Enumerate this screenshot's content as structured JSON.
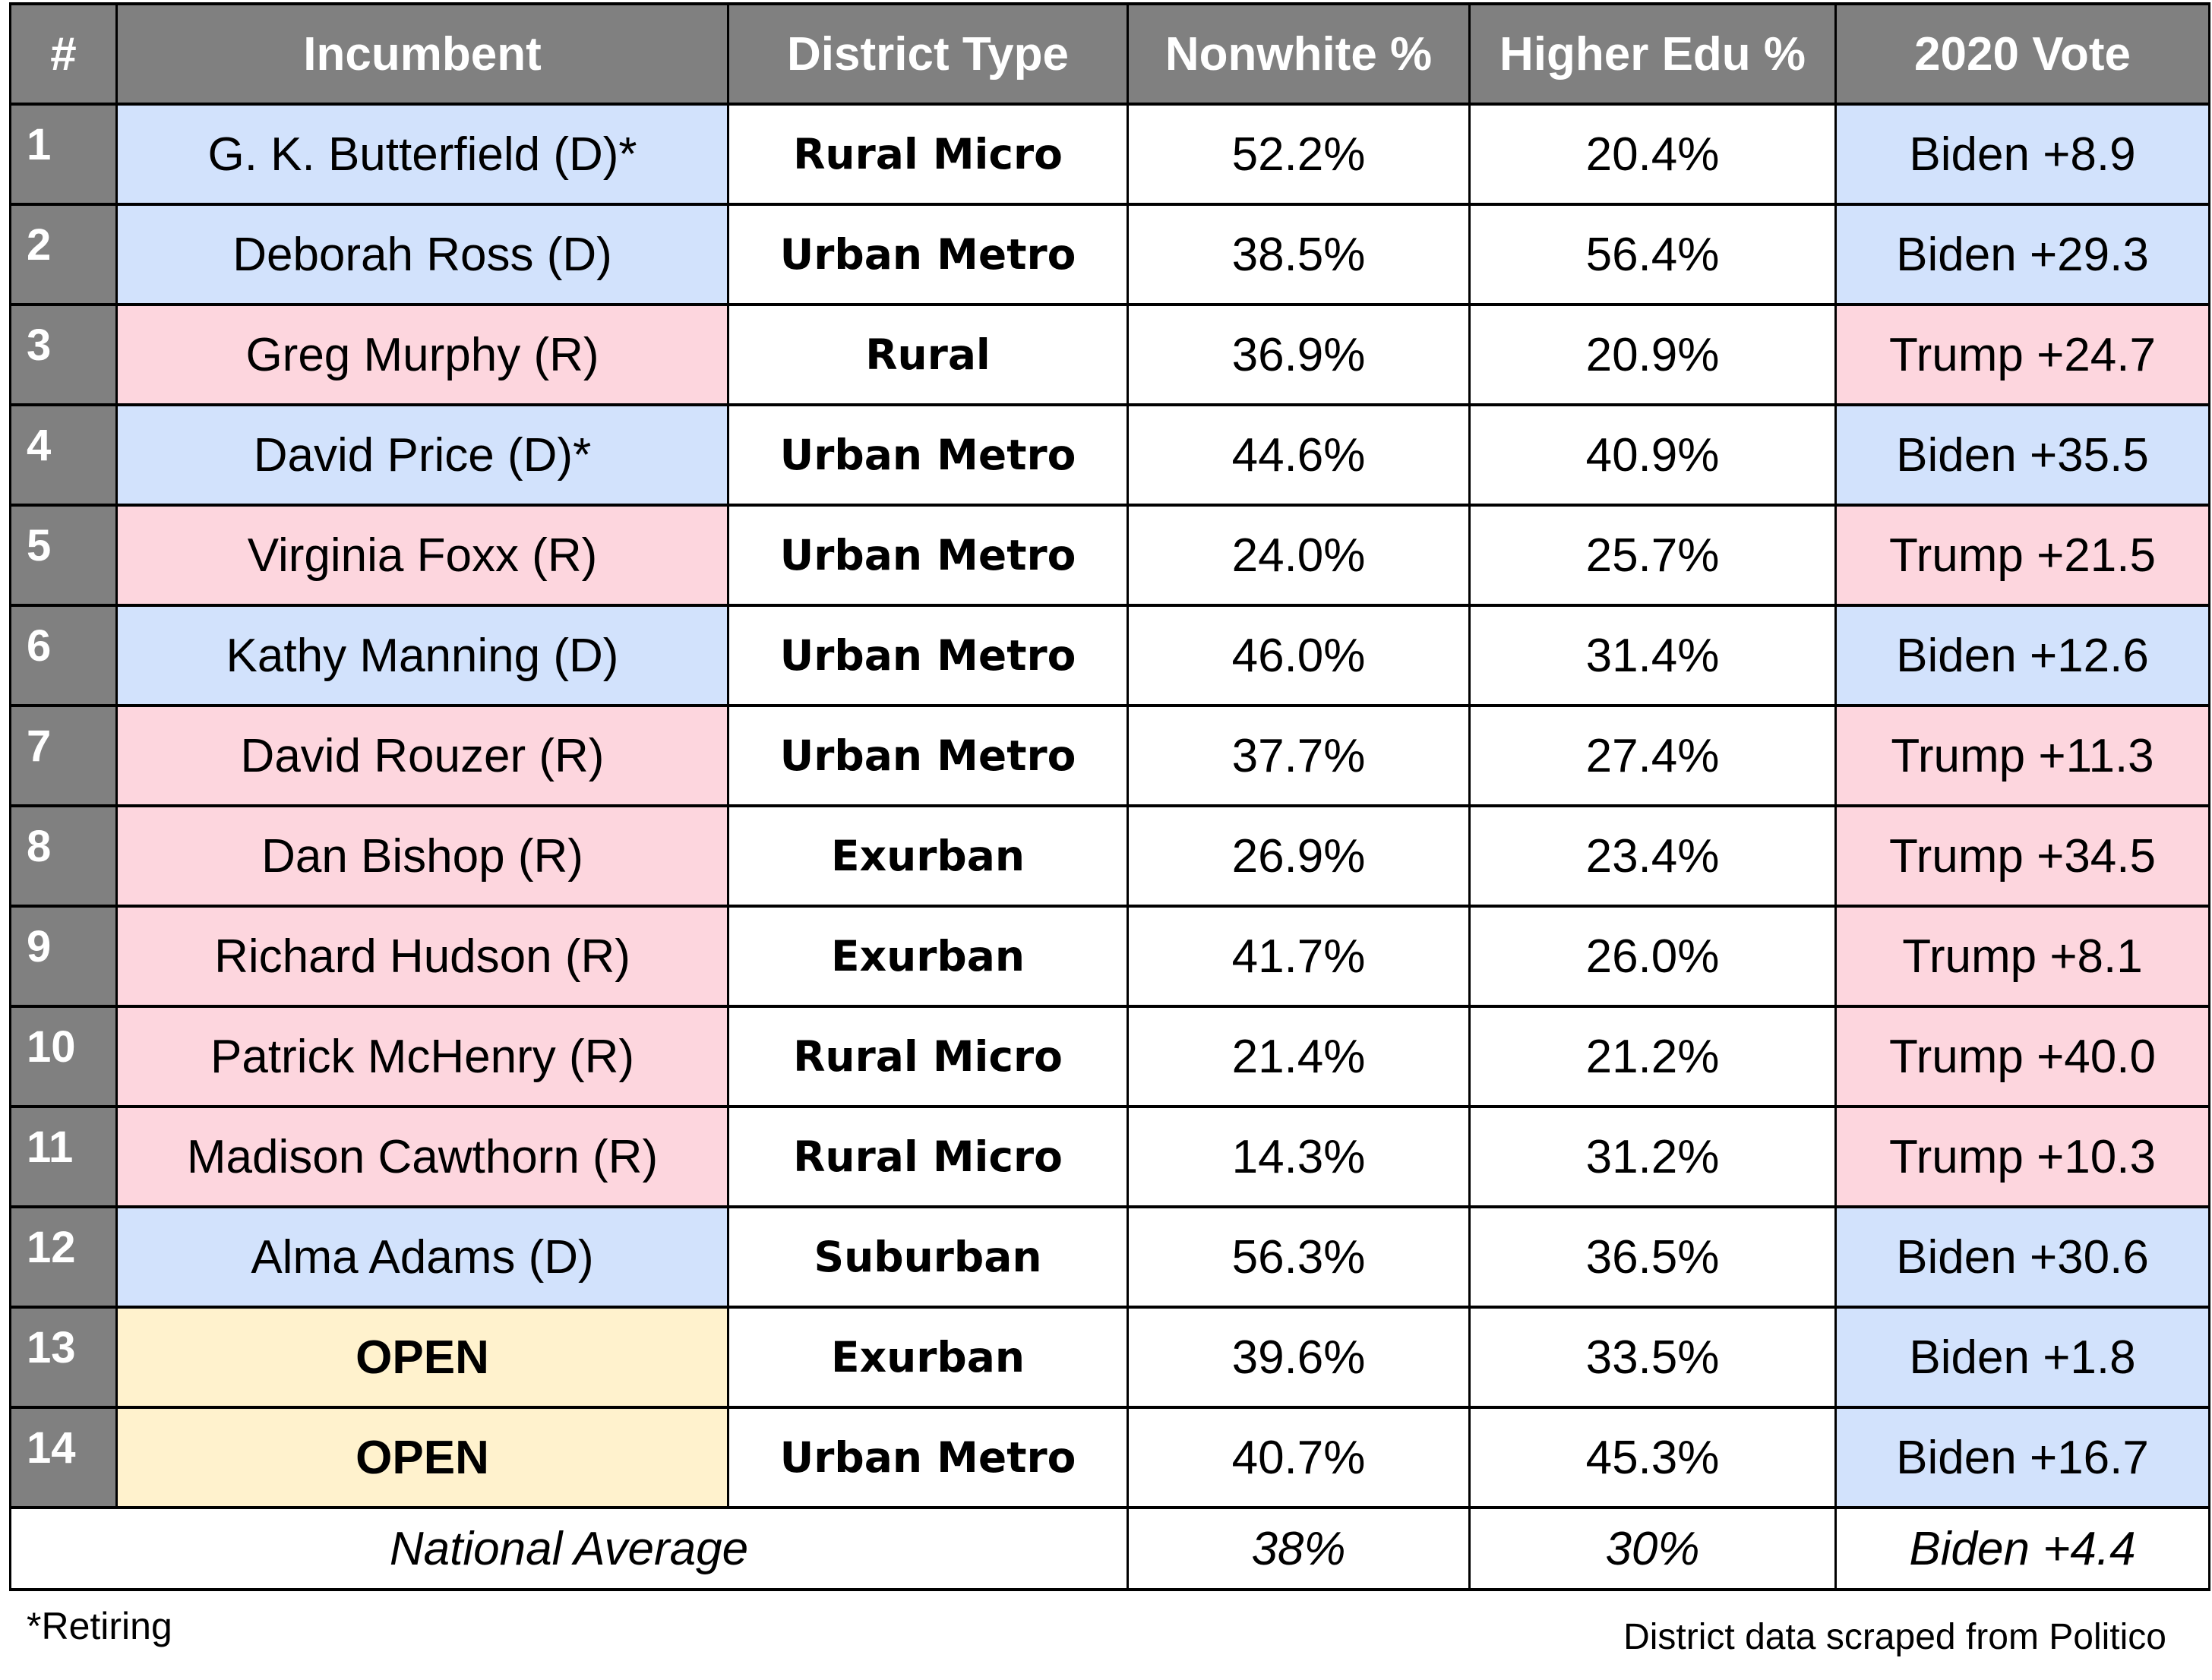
{
  "table": {
    "columns": [
      "#",
      "Incumbent",
      "District Type",
      "Nonwhite %",
      "Higher Edu %",
      "2020 Vote"
    ],
    "rows": [
      {
        "num": "1",
        "incumbent": "G. K. Butterfield (D)*",
        "party": "D",
        "district_type": "Rural Micro",
        "nonwhite": "52.2%",
        "higher_edu": "20.4%",
        "vote": "Biden +8.9",
        "vote_party": "D"
      },
      {
        "num": "2",
        "incumbent": "Deborah Ross (D)",
        "party": "D",
        "district_type": "Urban Metro",
        "nonwhite": "38.5%",
        "higher_edu": "56.4%",
        "vote": "Biden +29.3",
        "vote_party": "D"
      },
      {
        "num": "3",
        "incumbent": "Greg Murphy (R)",
        "party": "R",
        "district_type": "Rural",
        "nonwhite": "36.9%",
        "higher_edu": "20.9%",
        "vote": "Trump +24.7",
        "vote_party": "R"
      },
      {
        "num": "4",
        "incumbent": "David Price (D)*",
        "party": "D",
        "district_type": "Urban Metro",
        "nonwhite": "44.6%",
        "higher_edu": "40.9%",
        "vote": "Biden +35.5",
        "vote_party": "D"
      },
      {
        "num": "5",
        "incumbent": "Virginia Foxx (R)",
        "party": "R",
        "district_type": "Urban Metro",
        "nonwhite": "24.0%",
        "higher_edu": "25.7%",
        "vote": "Trump +21.5",
        "vote_party": "R"
      },
      {
        "num": "6",
        "incumbent": "Kathy Manning (D)",
        "party": "D",
        "district_type": "Urban Metro",
        "nonwhite": "46.0%",
        "higher_edu": "31.4%",
        "vote": "Biden +12.6",
        "vote_party": "D"
      },
      {
        "num": "7",
        "incumbent": "David Rouzer (R)",
        "party": "R",
        "district_type": "Urban Metro",
        "nonwhite": "37.7%",
        "higher_edu": "27.4%",
        "vote": "Trump +11.3",
        "vote_party": "R"
      },
      {
        "num": "8",
        "incumbent": "Dan Bishop (R)",
        "party": "R",
        "district_type": "Exurban",
        "nonwhite": "26.9%",
        "higher_edu": "23.4%",
        "vote": "Trump +34.5",
        "vote_party": "R"
      },
      {
        "num": "9",
        "incumbent": "Richard Hudson (R)",
        "party": "R",
        "district_type": "Exurban",
        "nonwhite": "41.7%",
        "higher_edu": "26.0%",
        "vote": "Trump +8.1",
        "vote_party": "R"
      },
      {
        "num": "10",
        "incumbent": "Patrick McHenry (R)",
        "party": "R",
        "district_type": "Rural Micro",
        "nonwhite": "21.4%",
        "higher_edu": "21.2%",
        "vote": "Trump +40.0",
        "vote_party": "R"
      },
      {
        "num": "11",
        "incumbent": "Madison Cawthorn (R)",
        "party": "R",
        "district_type": "Rural Micro",
        "nonwhite": "14.3%",
        "higher_edu": "31.2%",
        "vote": "Trump +10.3",
        "vote_party": "R"
      },
      {
        "num": "12",
        "incumbent": "Alma Adams (D)",
        "party": "D",
        "district_type": "Suburban",
        "nonwhite": "56.3%",
        "higher_edu": "36.5%",
        "vote": "Biden +30.6",
        "vote_party": "D"
      },
      {
        "num": "13",
        "incumbent": "OPEN",
        "party": "OPEN",
        "district_type": "Exurban",
        "nonwhite": "39.6%",
        "higher_edu": "33.5%",
        "vote": "Biden +1.8",
        "vote_party": "D"
      },
      {
        "num": "14",
        "incumbent": "OPEN",
        "party": "OPEN",
        "district_type": "Urban Metro",
        "nonwhite": "40.7%",
        "higher_edu": "45.3%",
        "vote": "Biden +16.7",
        "vote_party": "D"
      }
    ],
    "national_average": {
      "label": "National Average",
      "nonwhite": "38%",
      "higher_edu": "30%",
      "vote": "Biden +4.4"
    }
  },
  "colors": {
    "header_bg": "#808080",
    "democrat_bg": "#d2e2fc",
    "republican_bg": "#fdd6de",
    "open_bg": "#fff2cd"
  },
  "footer": {
    "footnote": "*Retiring",
    "source": "District data scraped from Politico"
  }
}
